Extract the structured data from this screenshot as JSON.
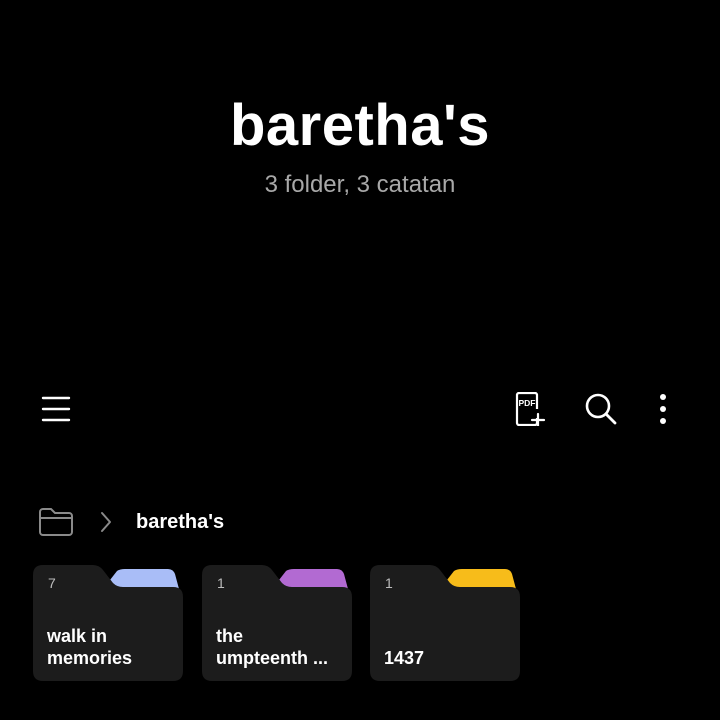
{
  "header": {
    "title": "baretha's",
    "subtitle": "3 folder, 3 catatan"
  },
  "toolbar": {
    "menu_icon": "hamburger-menu-icon",
    "pdf_label": "PDF",
    "pdf_icon": "pdf-add-icon",
    "search_icon": "search-icon",
    "more_icon": "more-vertical-icon"
  },
  "breadcrumb": {
    "root_icon": "folder-icon",
    "separator_icon": "chevron-right-icon",
    "current": "baretha's"
  },
  "folders": [
    {
      "count": "7",
      "name": "walk in\nmemories",
      "tab_color": "#a9bdf7"
    },
    {
      "count": "1",
      "name": "the\numpteenth ...",
      "tab_color": "#b26ad2"
    },
    {
      "count": "1",
      "name": "1437",
      "tab_color": "#f7bc1a"
    }
  ],
  "colors": {
    "background": "#000000",
    "card": "#1c1c1c",
    "subtitle": "#a8a8a8"
  }
}
